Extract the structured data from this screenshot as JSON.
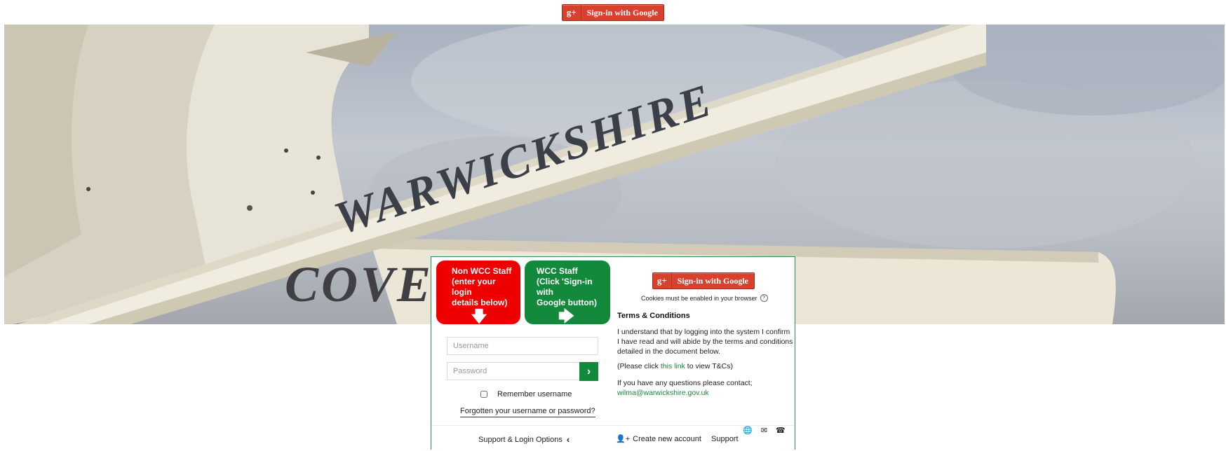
{
  "top_google_button": {
    "icon": "g+",
    "label": "Sign-in with Google"
  },
  "hero": {
    "sign_text_main": "WARWICKSHIRE",
    "sign_text_lower": "COVE"
  },
  "tiles": {
    "non_wcc": {
      "line1": "Non WCC Staff",
      "line2": "(enter your login",
      "line3": "details below)",
      "arrow": "🡇"
    },
    "wcc": {
      "line1": "WCC Staff",
      "line2": "(Click 'Sign-in with",
      "line3": "Google button)",
      "arrow": "🡆"
    }
  },
  "login": {
    "username_placeholder": "Username",
    "password_placeholder": "Password",
    "go_icon": "›",
    "remember_label": "Remember username",
    "forgot_link": "Forgotten your username or password?"
  },
  "card_google_button": {
    "icon": "g+",
    "label": "Sign-in with Google"
  },
  "cookies_note": "Cookies must be enabled in your browser",
  "terms": {
    "title": "Terms & Conditions",
    "body": "I understand that by logging into the system I confirm I have read and will abide by the terms and conditions detailed in the document below.",
    "click_prefix": "(Please click ",
    "click_link": "this link",
    "click_suffix": " to view T&Cs)",
    "contact_text": "If you have any questions please contact;",
    "contact_email": "wilma@warwickshire.gov.uk"
  },
  "footer": {
    "support_options": "Support & Login Options",
    "support_chevron": "‹",
    "create_account": "Create new account",
    "create_icon": "👤+",
    "support": "Support",
    "globe_icon": "🌐",
    "mail_icon": "✉",
    "phone_icon": "☎"
  }
}
